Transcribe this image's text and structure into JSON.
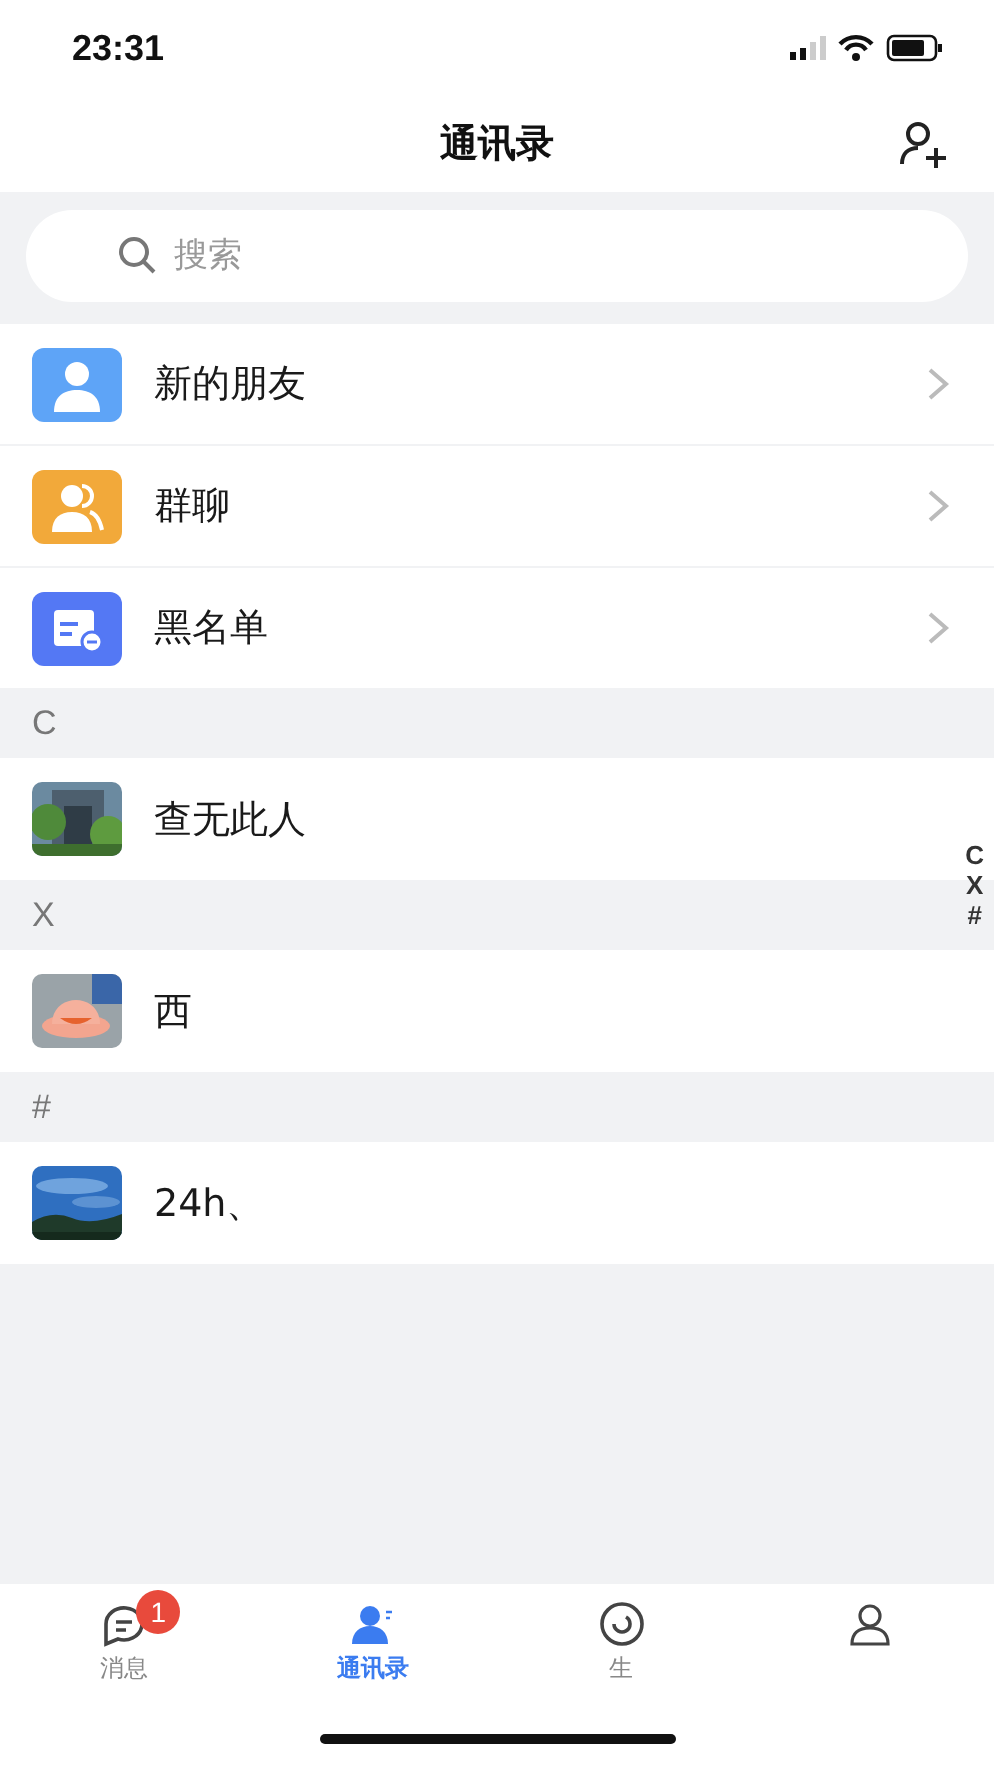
{
  "status_bar": {
    "time": "23:31"
  },
  "header": {
    "title": "通讯录"
  },
  "search": {
    "placeholder": "搜索"
  },
  "menu": [
    {
      "kind": "friends",
      "label": "新的朋友"
    },
    {
      "kind": "groups",
      "label": "群聊"
    },
    {
      "kind": "blacklist",
      "label": "黑名单"
    }
  ],
  "sections": [
    {
      "letter": "C",
      "contacts": [
        {
          "name": "查无此人"
        }
      ]
    },
    {
      "letter": "X",
      "contacts": [
        {
          "name": "西"
        }
      ]
    },
    {
      "letter": "#",
      "contacts": [
        {
          "name": "24h、"
        }
      ]
    }
  ],
  "index": [
    "C",
    "X",
    "#"
  ],
  "tabs": [
    {
      "kind": "messages",
      "label": "消息",
      "badge": "1",
      "selected": false
    },
    {
      "kind": "contacts",
      "label": "通讯录",
      "selected": true
    },
    {
      "kind": "moments",
      "label": "生",
      "selected": false
    },
    {
      "kind": "me",
      "selected": false
    }
  ]
}
